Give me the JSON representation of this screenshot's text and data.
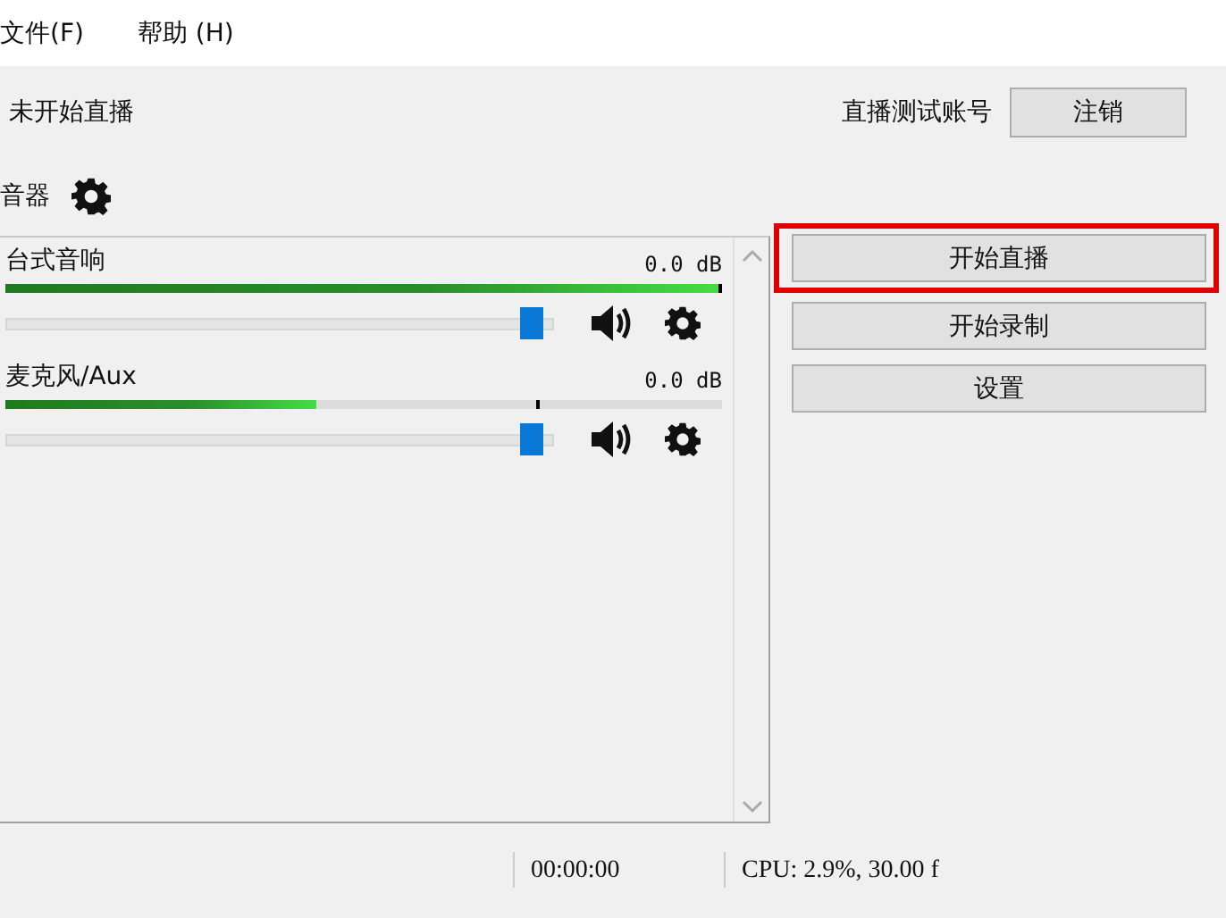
{
  "menu": [
    {
      "label": "文件(F)"
    },
    {
      "label": "帮助 (H)"
    }
  ],
  "status": "未开始直播",
  "account": {
    "name": "直播测试账号",
    "button": "注销"
  },
  "mixer": {
    "title": "音器",
    "channels": [
      {
        "name": "台式音响",
        "reading": "0.0 dB",
        "meter": {
          "level": 0.995,
          "peak": {
            "level": 0.995
          }
        },
        "volume": {
          "level": 0.98
        }
      },
      {
        "name": "麦克风/Aux",
        "reading": "0.0 dB",
        "meter": {
          "level": 0.435,
          "peak": {
            "level": 0.74
          }
        },
        "volume": {
          "level": 0.98
        }
      }
    ]
  },
  "buttons": [
    {
      "label": "开始直播",
      "highlighted": true
    },
    {
      "label": "开始录制",
      "highlighted": false
    },
    {
      "label": "设置",
      "highlighted": false
    }
  ],
  "status_bar": {
    "time": "00:00:00",
    "stats": "CPU: 2.9%, 30.00 f"
  }
}
